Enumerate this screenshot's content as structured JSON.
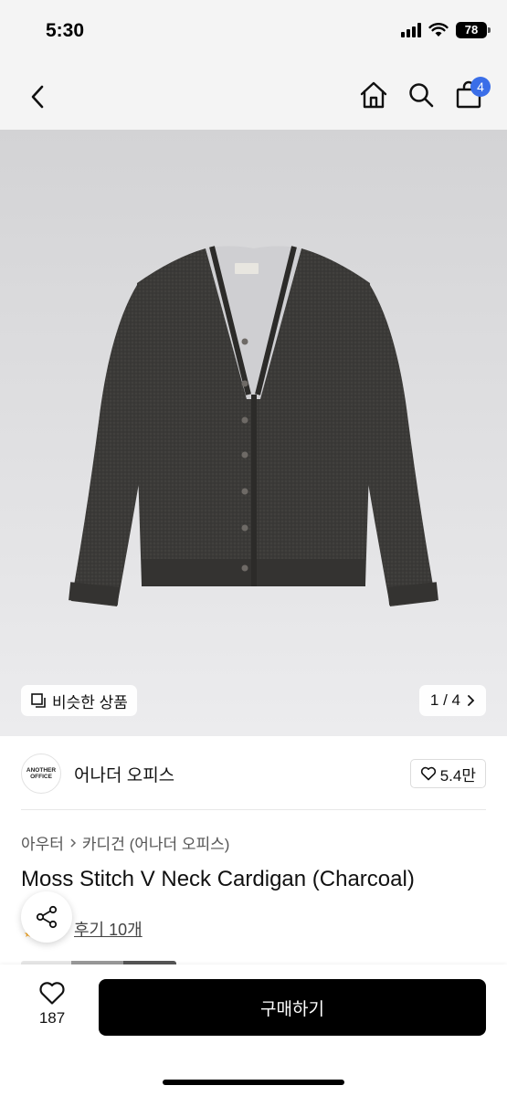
{
  "status_bar": {
    "time": "5:30",
    "battery": "78"
  },
  "nav": {
    "cart_count": "4"
  },
  "image": {
    "similar_label": "비슷한 상품",
    "page_indicator": "1 / 4",
    "brand_tag": "ANOTHER OFFICE"
  },
  "brand": {
    "logo_line1": "ANOTHER",
    "logo_line2": "OFFICE",
    "name": "어나더 오피스",
    "likes": "5.4만"
  },
  "breadcrumb": {
    "level1": "아우터",
    "level2": "카디건 (어나더 오피스)"
  },
  "product": {
    "title": "Moss Stitch V Neck Cardigan (Charcoal)",
    "reviews": "후기 10개"
  },
  "bottom": {
    "wish_count": "187",
    "buy_label": "구매하기"
  },
  "colors": {
    "accent": "#3a6ee8",
    "buy_button": "#000000",
    "cardigan": "#3b3a38"
  }
}
